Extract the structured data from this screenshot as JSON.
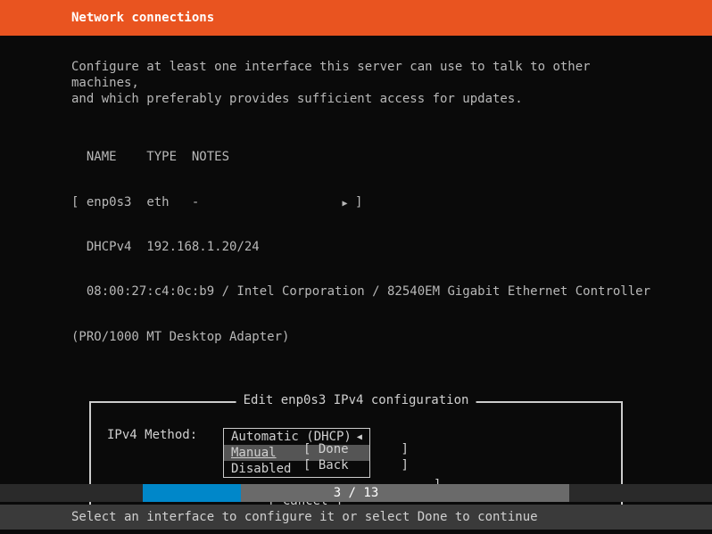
{
  "header": {
    "title": "Network connections"
  },
  "intro": {
    "line1": "Configure at least one interface this server can use to talk to other machines,",
    "line2": "and which preferably provides sufficient access for updates."
  },
  "iface": {
    "header_name": "NAME",
    "header_type": "TYPE",
    "header_notes": "NOTES",
    "row_open": "[",
    "row_name": "enp0s3",
    "row_type": "eth",
    "row_notes": "-",
    "row_close": "]",
    "dhcp_label": "DHCPv4",
    "dhcp_addr": "192.168.1.20/24",
    "mac_info": "08:00:27:c4:0c:b9 / Intel Corporation / 82540EM Gigabit Ethernet Controller",
    "model": "(PRO/1000 MT Desktop Adapter)"
  },
  "dialog": {
    "title": "Edit enp0s3 IPv4 configuration",
    "method_label": "IPv4 Method:",
    "options": {
      "auto": "Automatic (DHCP)",
      "manual": "Manual",
      "disabled": "Disabled"
    },
    "cancel": "[ Cancel    ]"
  },
  "footer": {
    "done": "[ Done       ]",
    "back": "[ Back       ]"
  },
  "progress": {
    "text": "3 / 13"
  },
  "hint": {
    "text": "Select an interface to configure it or select Done to continue"
  }
}
